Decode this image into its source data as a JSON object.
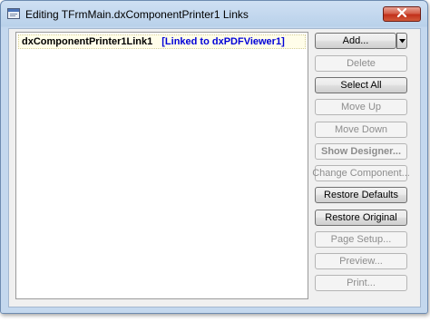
{
  "window": {
    "title": "Editing TFrmMain.dxComponentPrinter1 Links",
    "close_glyph": "x"
  },
  "list": {
    "items": [
      {
        "name": "dxComponentPrinter1Link1",
        "link_text": "[Linked to dxPDFViewer1]"
      }
    ]
  },
  "buttons": {
    "add": "Add...",
    "delete": "Delete",
    "select_all": "Select All",
    "move_up": "Move Up",
    "move_down": "Move Down",
    "show_designer": "Show Designer...",
    "change_component": "Change Component...",
    "restore_defaults": "Restore Defaults",
    "restore_original": "Restore Original",
    "page_setup": "Page Setup...",
    "preview": "Preview...",
    "print": "Print..."
  },
  "colors": {
    "link_text": "#0000d8",
    "close_button": "#c2301b",
    "title_bar": "#b9d1ea"
  }
}
